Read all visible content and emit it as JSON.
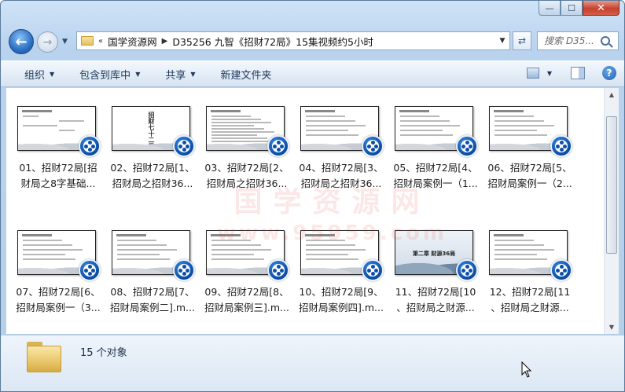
{
  "window": {
    "caption_buttons": {
      "minimize": "—",
      "maximize": "☐",
      "close": "✕"
    }
  },
  "nav": {
    "back_icon": "←",
    "forward_icon": "→",
    "address": {
      "overflow": "«",
      "crumbs": [
        "国学资源网",
        "D35256 九智《招财72局》15集视频约5小时"
      ]
    },
    "search_placeholder": "搜索 D35..."
  },
  "toolbar": {
    "organize": "组织",
    "include_library": "包含到库中",
    "share": "共享",
    "new_folder": "新建文件夹"
  },
  "watermark": {
    "line1": "国学资源网",
    "line2": "www.95959.com"
  },
  "files": [
    {
      "line1": "01、招财72局[招",
      "line2": "财局之8字基础...",
      "style": "chart"
    },
    {
      "line1": "02、招财72局[1、",
      "line2": "招财局之招财36...",
      "style": "title",
      "thumb_text": "招财七十二局"
    },
    {
      "line1": "03、招财72局[2、",
      "line2": "招财局之招财36...",
      "style": "dense"
    },
    {
      "line1": "04、招财72局[3、",
      "line2": "招财局之招财36...",
      "style": "text"
    },
    {
      "line1": "05、招财72局[4、",
      "line2": "招财局案例一（1...",
      "style": "text"
    },
    {
      "line1": "06、招财72局[5、",
      "line2": "招财局案例一（2...",
      "style": "text"
    },
    {
      "line1": "07、招财72局[6、",
      "line2": "招财局案例一（3...",
      "style": "text"
    },
    {
      "line1": "08、招财72局[7、",
      "line2": "招财局案例二].m...",
      "style": "text"
    },
    {
      "line1": "09、招财72局[8、",
      "line2": "招财局案例三].m...",
      "style": "text"
    },
    {
      "line1": "10、招财72局[9、",
      "line2": "招财局案例四].m...",
      "style": "text"
    },
    {
      "line1": "11、招财72局[10",
      "line2": "、招财局之财源...",
      "style": "chapter",
      "thumb_text": "第二章 财源36局"
    },
    {
      "line1": "12、招财72局[11",
      "line2": "、招财局之财源...",
      "style": "text"
    }
  ],
  "status": {
    "count": "15 个对象"
  }
}
